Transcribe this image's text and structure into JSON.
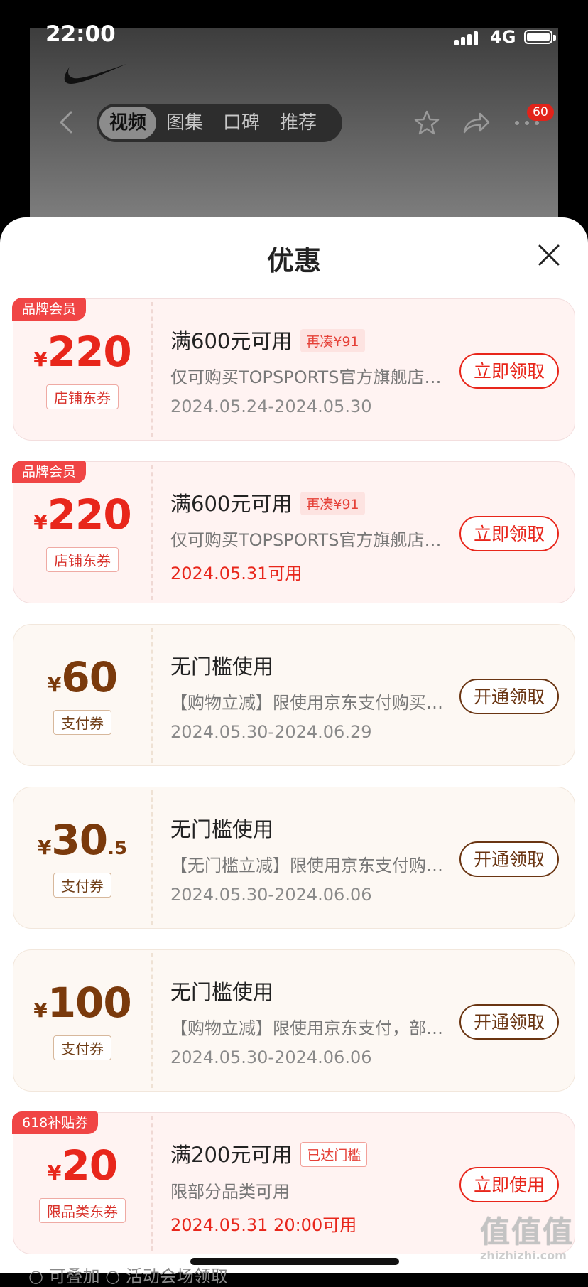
{
  "status_bar": {
    "time": "22:00",
    "network": "4G"
  },
  "header": {
    "tabs": [
      {
        "label": "视频",
        "active": true
      },
      {
        "label": "图集",
        "active": false
      },
      {
        "label": "口碑",
        "active": false
      },
      {
        "label": "推荐",
        "active": false
      }
    ],
    "more_badge": "60"
  },
  "sheet": {
    "title": "优惠",
    "coupons": [
      {
        "tag": "品牌会员",
        "currency": "¥",
        "amount": "220",
        "decimal": "",
        "type_label": "店铺东券",
        "condition": "满600元可用",
        "condition_badge": "再凑¥91",
        "description": "仅可购买TOPSPORTS官方旗舰店部分商品",
        "date": "2024.05.24-2024.05.30",
        "action": "立即领取"
      },
      {
        "tag": "品牌会员",
        "currency": "¥",
        "amount": "220",
        "decimal": "",
        "type_label": "店铺东券",
        "condition": "满600元可用",
        "condition_badge": "再凑¥91",
        "description": "仅可购买TOPSPORTS官方旗舰店部分商品",
        "date": "2024.05.31可用",
        "action": "立即领取"
      },
      {
        "tag": "",
        "currency": "¥",
        "amount": "60",
        "decimal": "",
        "type_label": "支付券",
        "condition": "无门槛使用",
        "condition_badge": "",
        "description": "【购物立减】限使用京东支付购买指定商品",
        "date": "2024.05.30-2024.06.29",
        "action": "开通领取"
      },
      {
        "tag": "",
        "currency": "¥",
        "amount": "30",
        "decimal": ".5",
        "type_label": "支付券",
        "condition": "无门槛使用",
        "condition_badge": "",
        "description": "【无门槛立减】限使用京东支付购买指定商品",
        "date": "2024.05.30-2024.06.06",
        "action": "开通领取"
      },
      {
        "tag": "",
        "currency": "¥",
        "amount": "100",
        "decimal": "",
        "type_label": "支付券",
        "condition": "无门槛使用",
        "condition_badge": "",
        "description": "【购物立减】限使用京东支付，部分商品可用",
        "date": "2024.05.30-2024.06.06",
        "action": "开通领取"
      },
      {
        "tag": "618补贴券",
        "currency": "¥",
        "amount": "20",
        "decimal": "",
        "type_label": "限品类东券",
        "condition": "满200元可用",
        "condition_badge": "已达门槛",
        "description": "限部分品类可用",
        "date": "2024.05.31 20:00可用",
        "action": "立即使用"
      }
    ],
    "footer_hint": "○ 可叠加   ○ 活动会场领取"
  },
  "watermark": {
    "main": "值值值",
    "sub": "zhizhizhi.com"
  },
  "colors": {
    "accent_red": "#e8261b",
    "accent_brown": "#6a3512",
    "tag_red": "#f04545"
  }
}
